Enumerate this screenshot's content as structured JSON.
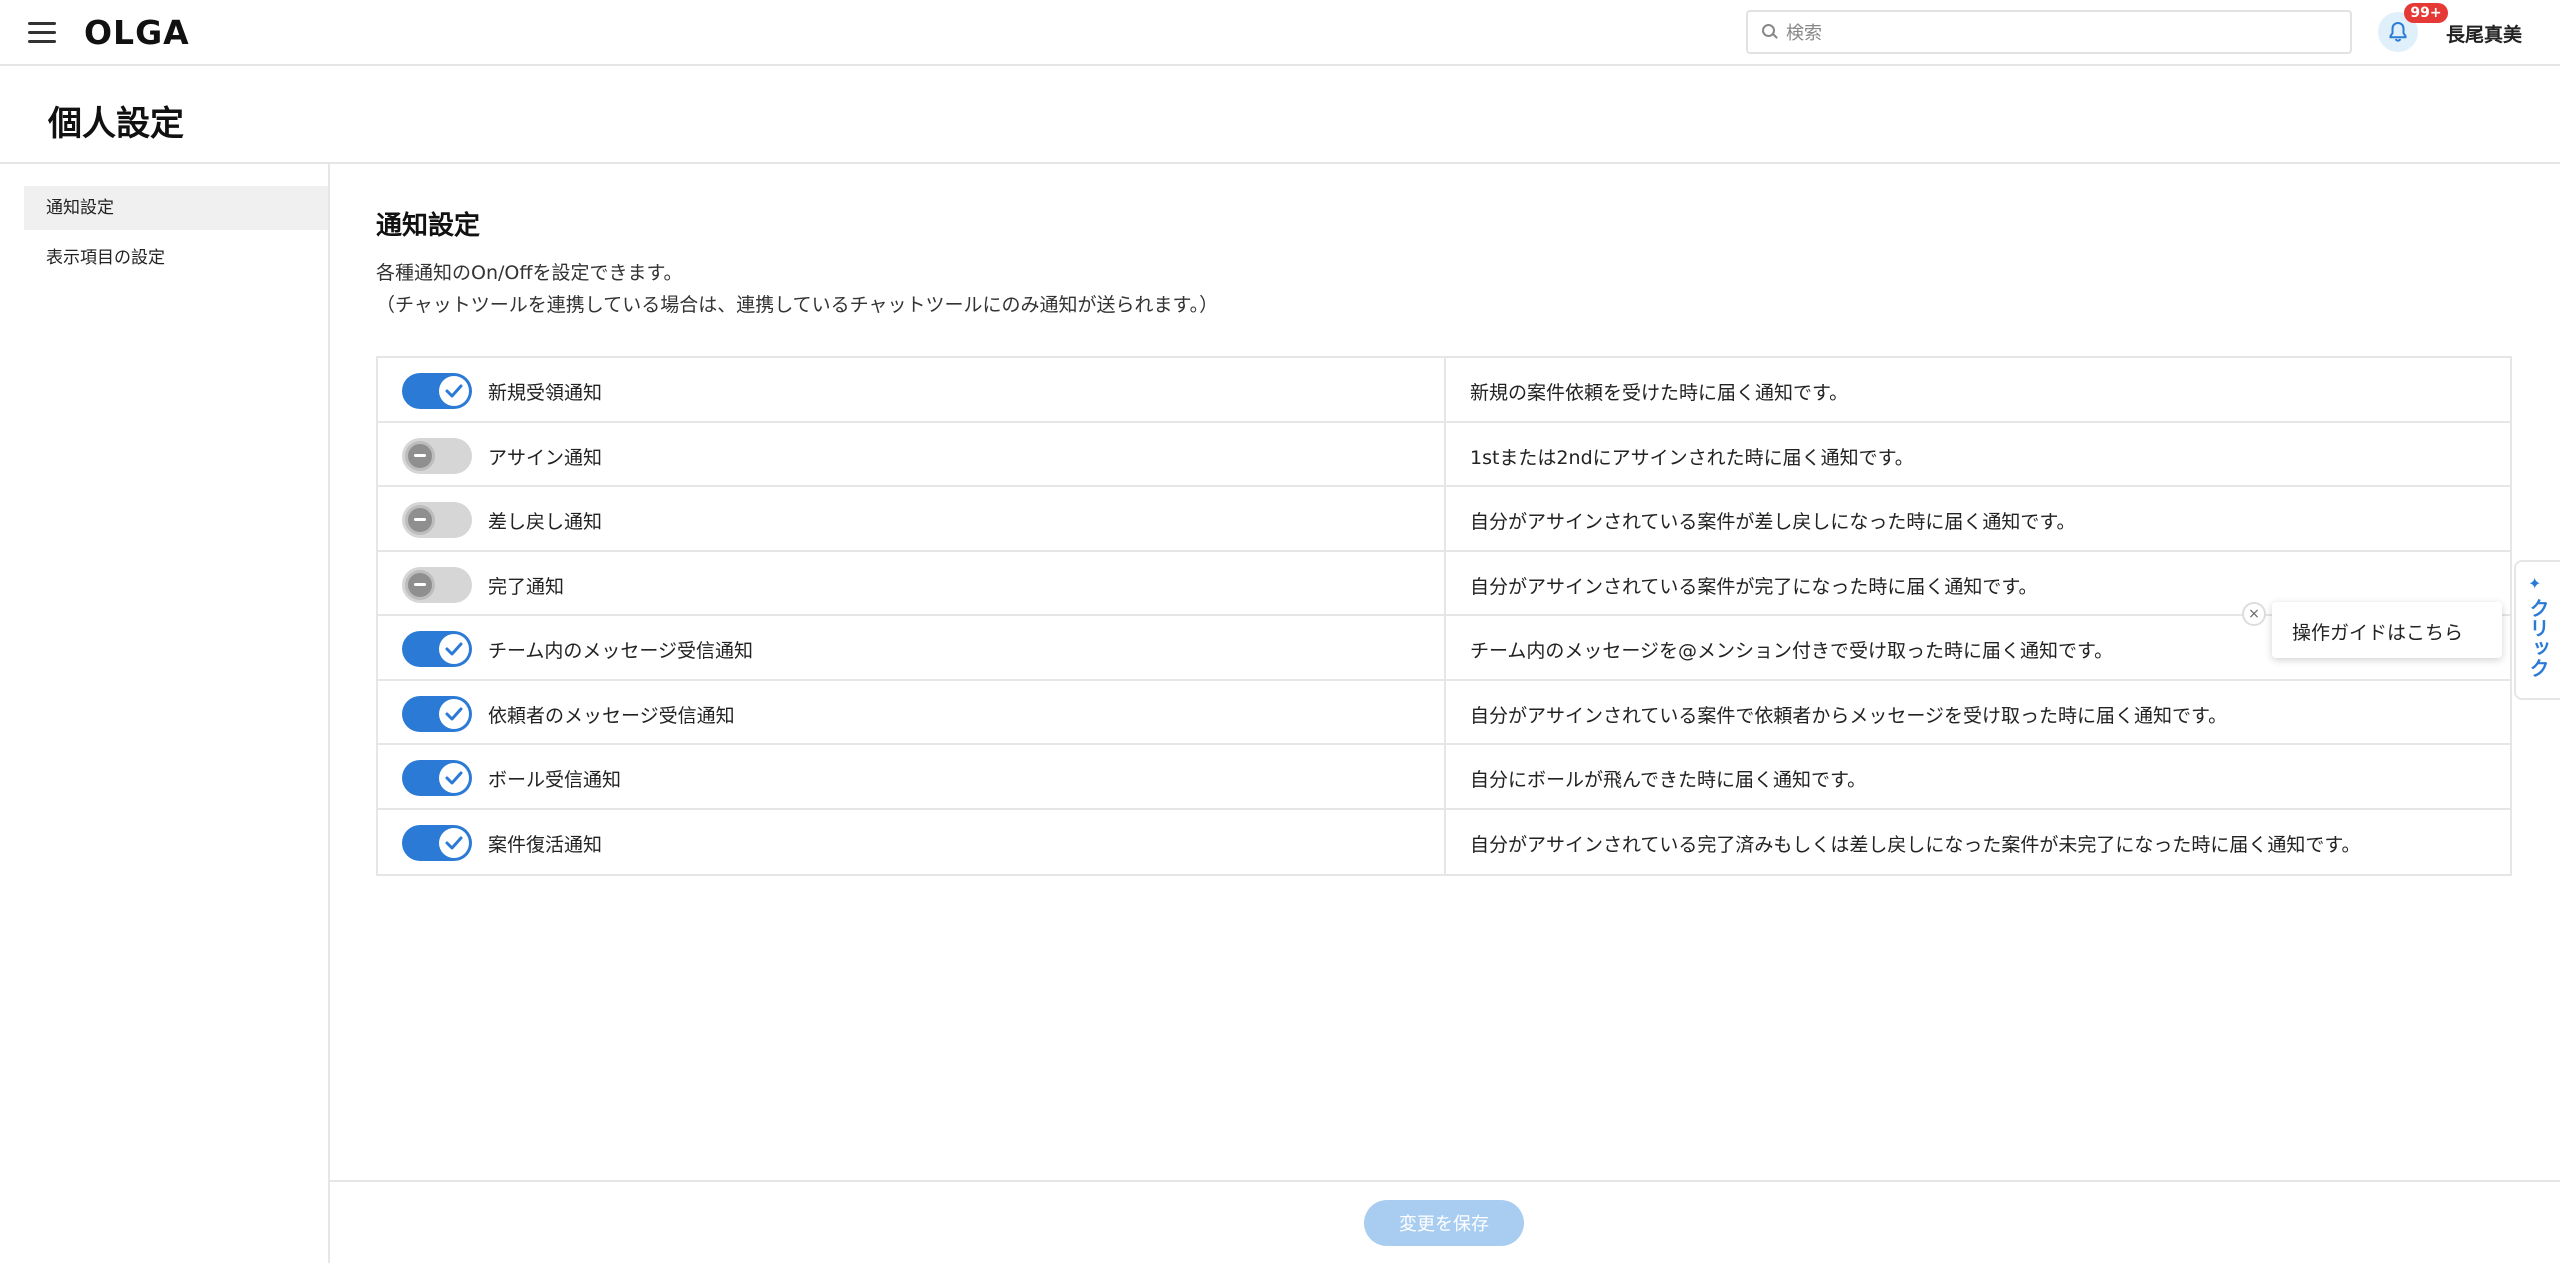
{
  "header": {
    "logo": "OLGA",
    "search_placeholder": "検索",
    "notification_badge": "99+",
    "user_name": "長尾真美"
  },
  "page": {
    "title": "個人設定"
  },
  "sidebar": {
    "items": [
      {
        "label": "通知設定",
        "active": true
      },
      {
        "label": "表示項目の設定",
        "active": false
      }
    ]
  },
  "main": {
    "section_title": "通知設定",
    "description_line1": "各種通知のOn/Offを設定できます。",
    "description_line2": "（チャットツールを連携している場合は、連携しているチャットツールにのみ通知が送られます。）",
    "notifications": [
      {
        "label": "新規受領通知",
        "enabled": true,
        "detail": "新規の案件依頼を受けた時に届く通知です。"
      },
      {
        "label": "アサイン通知",
        "enabled": false,
        "detail": "1stまたは2ndにアサインされた時に届く通知です。"
      },
      {
        "label": "差し戻し通知",
        "enabled": false,
        "detail": "自分がアサインされている案件が差し戻しになった時に届く通知です。"
      },
      {
        "label": "完了通知",
        "enabled": false,
        "detail": "自分がアサインされている案件が完了になった時に届く通知です。"
      },
      {
        "label": "チーム内のメッセージ受信通知",
        "enabled": true,
        "detail": "チーム内のメッセージを@メンション付きで受け取った時に届く通知です。"
      },
      {
        "label": "依頼者のメッセージ受信通知",
        "enabled": true,
        "detail": "自分がアサインされている案件で依頼者からメッセージを受け取った時に届く通知です。"
      },
      {
        "label": "ボール受信通知",
        "enabled": true,
        "detail": "自分にボールが飛んできた時に届く通知です。"
      },
      {
        "label": "案件復活通知",
        "enabled": true,
        "detail": "自分がアサインされている完了済みもしくは差し戻しになった案件が未完了になった時に届く通知です。"
      }
    ]
  },
  "guide": {
    "text": "操作ガイドはこちら",
    "close": "×",
    "tab_label": "クリック"
  },
  "footer": {
    "save_label": "変更を保存"
  },
  "colors": {
    "accent": "#2b7bd6",
    "toggle_off": "#d6d6d6",
    "badge": "#e53935",
    "save_disabled": "#a9cdf0"
  }
}
